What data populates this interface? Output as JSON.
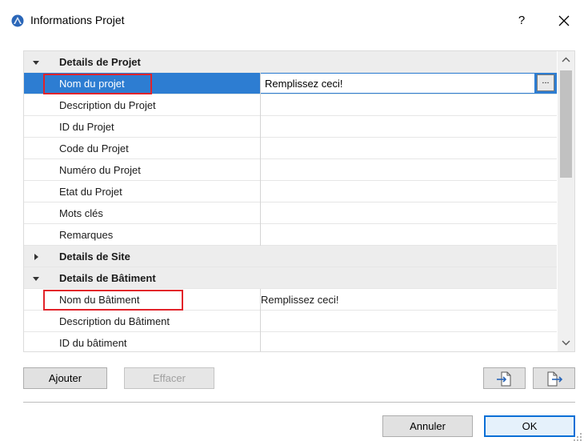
{
  "window": {
    "title": "Informations Projet",
    "help_label": "?",
    "close_icon": "close-icon",
    "app_icon": "archicad-logo-icon"
  },
  "tree": {
    "rows": [
      {
        "kind": "group",
        "label": "Details de Projet",
        "expanded": true
      },
      {
        "kind": "item",
        "label": "Nom du projet",
        "value": "Remplissez ceci!",
        "selected": true,
        "highlighted": true,
        "browse_label": "..."
      },
      {
        "kind": "item",
        "label": "Description du Projet",
        "value": ""
      },
      {
        "kind": "item",
        "label": "ID du Projet",
        "value": ""
      },
      {
        "kind": "item",
        "label": "Code du Projet",
        "value": ""
      },
      {
        "kind": "item",
        "label": "Numéro du Projet",
        "value": ""
      },
      {
        "kind": "item",
        "label": "Etat du Projet",
        "value": ""
      },
      {
        "kind": "item",
        "label": "Mots clés",
        "value": ""
      },
      {
        "kind": "item",
        "label": "Remarques",
        "value": ""
      },
      {
        "kind": "group",
        "label": "Details de Site",
        "expanded": false
      },
      {
        "kind": "group",
        "label": "Details de Bâtiment",
        "expanded": true
      },
      {
        "kind": "item",
        "label": "Nom du Bâtiment",
        "value": "Remplissez ceci!",
        "highlighted": true
      },
      {
        "kind": "item",
        "label": "Description du Bâtiment",
        "value": ""
      },
      {
        "kind": "item",
        "label": "ID du bâtiment",
        "value": ""
      }
    ]
  },
  "buttons": {
    "add": "Ajouter",
    "delete": "Effacer",
    "import_icon": "import-icon",
    "export_icon": "export-icon",
    "cancel": "Annuler",
    "ok": "OK"
  },
  "colors": {
    "selection": "#2d7dd2",
    "highlight_border": "#e2232a",
    "ok_border": "#0a6fd6"
  }
}
